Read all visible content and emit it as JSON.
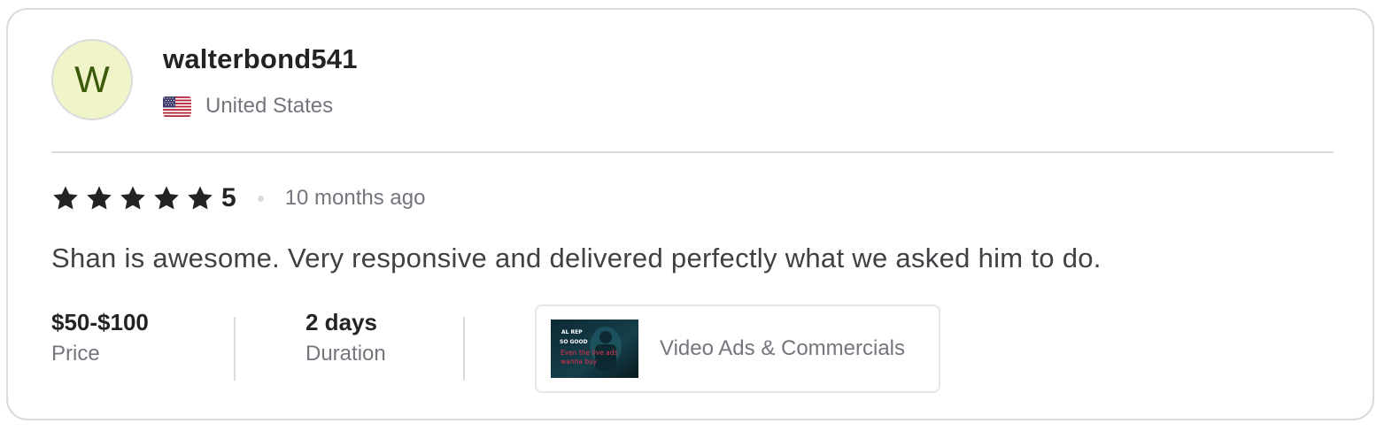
{
  "reviewer": {
    "avatar_initial": "W",
    "username": "walterbond541",
    "country": "United States",
    "flag_icon": "us-flag-icon"
  },
  "rating": {
    "value": "5",
    "stars": 5,
    "time_ago": "10 months ago"
  },
  "review": {
    "text": "Shan is awesome. Very responsive and delivered perfectly what we asked him to do."
  },
  "details": {
    "price_value": "$50-$100",
    "price_label": "Price",
    "duration_value": "2 days",
    "duration_label": "Duration"
  },
  "gig": {
    "title": "Video Ads & Commercials",
    "thumbnail_text": [
      "AL REP",
      "SO GOOD",
      "Even the live ads",
      "wanna buy"
    ]
  },
  "colors": {
    "avatar_bg": "#f1f4c9",
    "avatar_text": "#3b5b0a",
    "star": "#222325",
    "muted_text": "#74767e",
    "border": "#dadbdd"
  }
}
